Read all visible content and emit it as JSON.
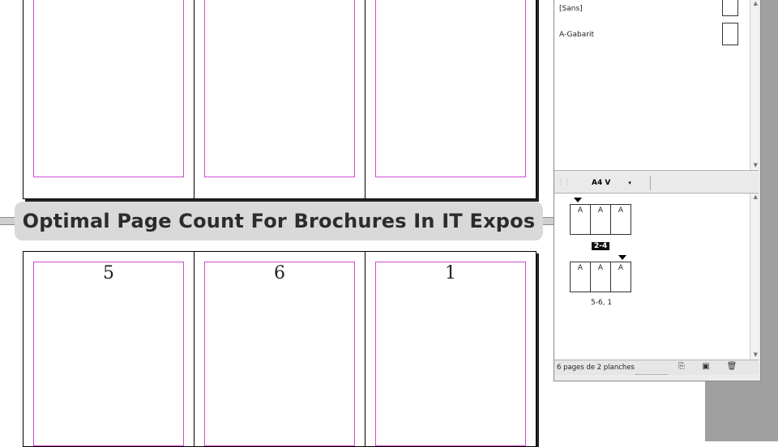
{
  "banner": {
    "title": "Optimal Page Count For Brochures In IT Expos"
  },
  "document": {
    "bottom_spread_page_numbers": [
      "5",
      "6",
      "1"
    ]
  },
  "pages_panel": {
    "masters": [
      {
        "name": "[Sans]"
      },
      {
        "name": "A-Gabarit"
      }
    ],
    "page_size": "A4 V",
    "page_size_chevron": "▾",
    "spreads": [
      {
        "pages": [
          "A",
          "A",
          "A"
        ],
        "label": "2-4",
        "selected": true
      },
      {
        "pages": [
          "A",
          "A",
          "A"
        ],
        "label": "5-6, 1",
        "selected": false
      }
    ],
    "status": "6 pages de 2 planches",
    "icons": {
      "new_page": "new-page-icon",
      "new_master": "new-master-icon",
      "trash": "trash-icon"
    }
  },
  "colors": {
    "margin_guide": "#d24ad2",
    "banner_bg": "#d9d9d9",
    "panel_bg": "#ececec"
  }
}
